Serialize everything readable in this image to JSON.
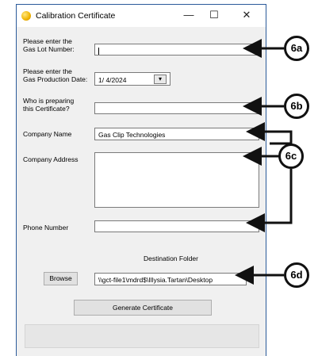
{
  "window": {
    "title": "Calibration Certificate",
    "minimize_glyph": "—",
    "maximize_glyph": "☐",
    "close_glyph": "✕"
  },
  "form": {
    "gas_lot": {
      "label_line1": "Please enter the",
      "label_line2": "Gas Lot Number:",
      "value": ""
    },
    "production_date": {
      "label_line1": "Please enter the",
      "label_line2": "Gas Production Date:",
      "value": "1/ 4/2024",
      "dropdown_glyph": "▾"
    },
    "preparer": {
      "label_line1": "Who is preparing",
      "label_line2": "this Certificate?",
      "value": ""
    },
    "company_name": {
      "label": "Company Name",
      "value": "Gas Clip Technologies"
    },
    "company_address": {
      "label": "Company Address",
      "value": ""
    },
    "phone": {
      "label": "Phone Number",
      "value": ""
    },
    "destination": {
      "label": "Destination Folder",
      "browse_label": "Browse",
      "value": "\\\\gct-file1\\mdrd$\\Illysia.Tartan\\Desktop"
    },
    "generate_label": "Generate Certificate",
    "status_text": ""
  },
  "callouts": [
    "6a",
    "6b",
    "6c",
    "6d"
  ]
}
